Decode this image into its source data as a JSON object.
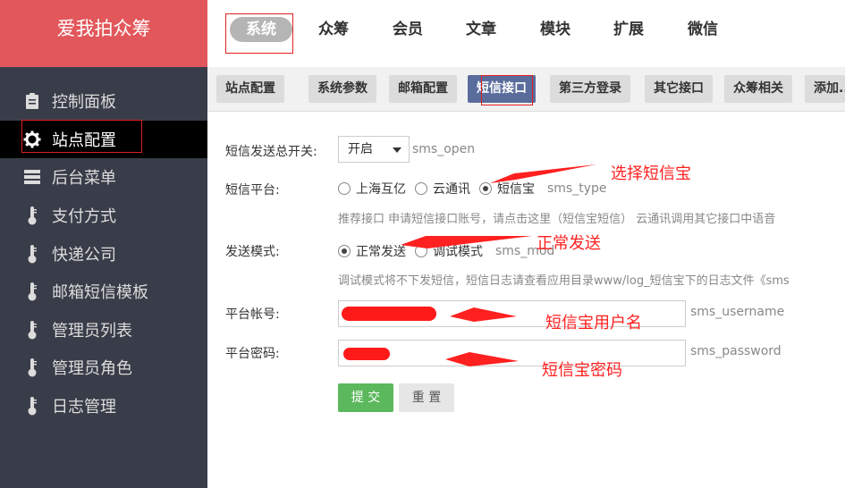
{
  "sidebar": {
    "logo": "爱我拍众筹",
    "items": [
      {
        "label": "控制面板",
        "icon": "clipboard-icon"
      },
      {
        "label": "站点配置",
        "icon": "gear-icon"
      },
      {
        "label": "后台菜单",
        "icon": "menu-icon"
      },
      {
        "label": "支付方式",
        "icon": "thermometer-icon"
      },
      {
        "label": "快递公司",
        "icon": "thermometer-icon"
      },
      {
        "label": "邮箱短信模板",
        "icon": "thermometer-icon"
      },
      {
        "label": "管理员列表",
        "icon": "thermometer-icon"
      },
      {
        "label": "管理员角色",
        "icon": "thermometer-icon"
      },
      {
        "label": "日志管理",
        "icon": "thermometer-icon"
      }
    ]
  },
  "topnav": {
    "items": [
      "系统",
      "众筹",
      "会员",
      "文章",
      "模块",
      "扩展",
      "微信"
    ]
  },
  "subtabs": [
    "站点配置",
    "系统参数",
    "邮箱配置",
    "短信接口",
    "第三方登录",
    "其它接口",
    "众筹相关",
    "添加..."
  ],
  "form": {
    "sms_open": {
      "label": "短信发送总开关:",
      "value": "开启",
      "field": "sms_open"
    },
    "sms_type": {
      "label": "短信平台:",
      "options": [
        "上海互亿",
        "云通讯",
        "短信宝"
      ],
      "selected": "短信宝",
      "field": "sms_type",
      "hint": "推荐接口 申请短信接口账号，请点击这里（短信宝短信） 云通讯调用其它接口中语音"
    },
    "sms_mod": {
      "label": "发送模式:",
      "options": [
        "正常发送",
        "调试模式"
      ],
      "selected": "正常发送",
      "field": "sms_mod",
      "hint": "调试模式将不下发短信，短信日志请查看应用目录www/log_短信宝下的日志文件《sms"
    },
    "sms_username": {
      "label": "平台帐号:",
      "field": "sms_username",
      "value": ""
    },
    "sms_password": {
      "label": "平台密码:",
      "field": "sms_password",
      "value": ""
    },
    "submit_label": "提 交",
    "reset_label": "重 置"
  },
  "annotations": {
    "select_platform": "选择短信宝",
    "normal_send": "正常发送",
    "username": "短信宝用户名",
    "password": "短信宝密码"
  },
  "colors": {
    "sidebar_bg": "#393d49",
    "logo_bg": "#e2575b",
    "active_tab": "#5a6c9c",
    "submit": "#5cb85c",
    "annotation": "#ff2020"
  }
}
